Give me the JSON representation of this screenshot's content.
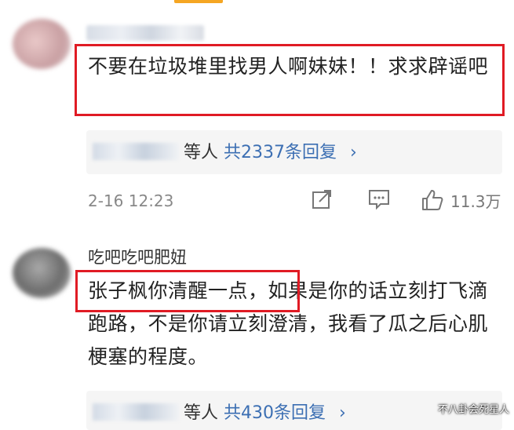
{
  "comments": [
    {
      "author": "",
      "text": "不要在垃圾堆里找男人啊妹妹！！求求辟谣吧",
      "reply_summary": {
        "suffix": "等人",
        "count_text": "共2337条回复"
      },
      "time": "2-16 12:23",
      "likes": "11.3万"
    },
    {
      "author": "吃吧吃吧肥妞",
      "text": "张子枫你清醒一点，如果是你的话立刻打飞滴跑路，不是你请立刻澄清，我看了瓜之后心肌梗塞的程度。",
      "reply_summary": {
        "suffix": "等人",
        "count_text": "共430条回复"
      }
    }
  ],
  "watermark": "不八卦会死星人",
  "icons": [
    "share-icon",
    "comment-icon",
    "like-icon",
    "chevron-right-icon"
  ],
  "colors": {
    "highlight": "#e01b24",
    "link": "#3c6fb3",
    "accent": "#f5a623"
  }
}
